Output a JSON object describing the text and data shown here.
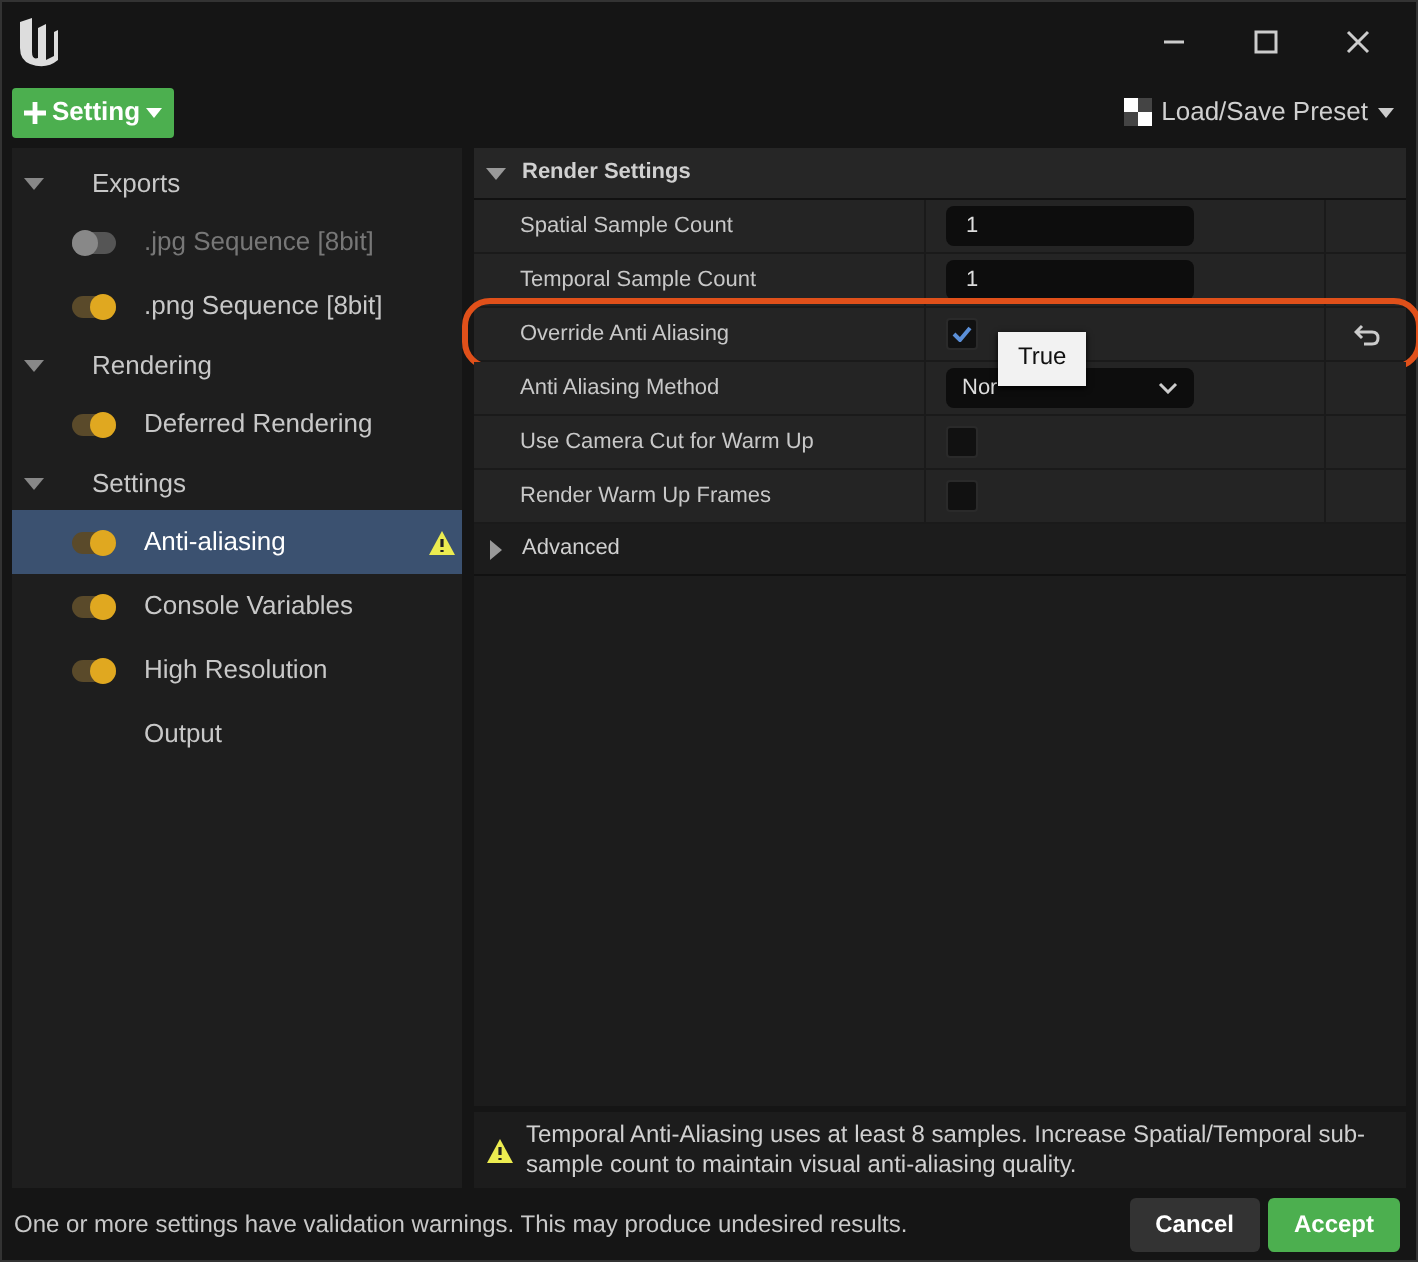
{
  "toolbar": {
    "add_button": "Setting",
    "preset_button": "Load/Save Preset"
  },
  "tree": [
    {
      "label": "Exports",
      "expanded": true,
      "children": [
        {
          "label": ".jpg Sequence [8bit]",
          "kind": "toggle",
          "on": false,
          "selected": false,
          "warning": false
        },
        {
          "label": ".png Sequence [8bit]",
          "kind": "toggle",
          "on": true,
          "selected": false,
          "warning": false
        }
      ]
    },
    {
      "label": "Rendering",
      "expanded": true,
      "children": [
        {
          "label": "Deferred Rendering",
          "kind": "toggle",
          "on": true,
          "selected": false,
          "warning": false
        }
      ]
    },
    {
      "label": "Settings",
      "expanded": true,
      "children": [
        {
          "label": "Anti-aliasing",
          "kind": "toggle",
          "on": true,
          "selected": true,
          "warning": true
        },
        {
          "label": "Console Variables",
          "kind": "toggle",
          "on": true,
          "selected": false,
          "warning": false
        },
        {
          "label": "High Resolution",
          "kind": "toggle",
          "on": true,
          "selected": false,
          "warning": false
        },
        {
          "label": "Output",
          "kind": "plain",
          "selected": false,
          "warning": false
        }
      ]
    }
  ],
  "details": [
    {
      "title": "Render Settings",
      "expanded": true,
      "rows": [
        {
          "label": "Spatial Sample Count",
          "kind": "number",
          "value": "1",
          "modified": false
        },
        {
          "label": "Temporal Sample Count",
          "kind": "number",
          "value": "1",
          "modified": false
        },
        {
          "label": "Override Anti Aliasing",
          "kind": "checkbox",
          "checked": true,
          "modified": true,
          "highlighted": true,
          "tooltip": "True"
        },
        {
          "label": "Anti Aliasing Method",
          "kind": "dropdown",
          "value": "Nor",
          "modified": false
        },
        {
          "label": "Use Camera Cut for Warm Up",
          "kind": "checkbox",
          "checked": false,
          "modified": false
        },
        {
          "label": "Render Warm Up Frames",
          "kind": "checkbox",
          "checked": false,
          "modified": false
        }
      ]
    },
    {
      "title": "Advanced",
      "expanded": false
    }
  ],
  "warning_message": "Temporal Anti-Aliasing uses at least 8 samples. Increase Spatial/Temporal sub-sample count to maintain visual anti-aliasing quality.",
  "status_message": "One or more settings have validation warnings. This may produce undesired results.",
  "buttons": [
    {
      "label": "Cancel",
      "kind": "secondary"
    },
    {
      "label": "Accept",
      "kind": "primary"
    }
  ]
}
